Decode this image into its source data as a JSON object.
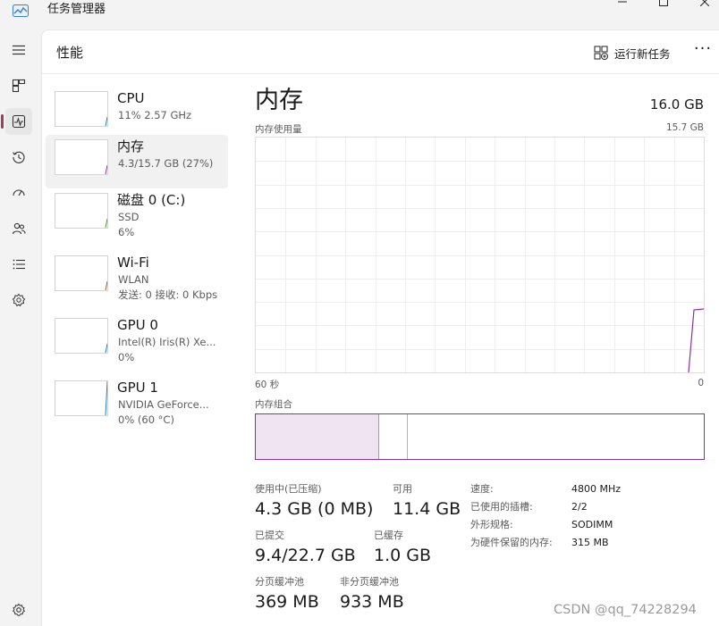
{
  "window": {
    "title": "任务管理器"
  },
  "nav": {
    "items": [
      {
        "id": "menu",
        "icon": "hamburger-icon"
      },
      {
        "id": "processes",
        "icon": "processes-icon"
      },
      {
        "id": "performance",
        "icon": "performance-icon",
        "active": true
      },
      {
        "id": "app-history",
        "icon": "history-icon"
      },
      {
        "id": "startup",
        "icon": "startup-icon"
      },
      {
        "id": "users",
        "icon": "users-icon"
      },
      {
        "id": "details",
        "icon": "details-icon"
      },
      {
        "id": "services",
        "icon": "services-icon"
      },
      {
        "id": "settings",
        "icon": "gear-icon"
      }
    ]
  },
  "header": {
    "title": "性能",
    "run_new_task": "运行新任务",
    "more": "···"
  },
  "resources": [
    {
      "name": "CPU",
      "sub1": "11%  2.57 GHz",
      "sub2": "",
      "color": "#1a7fd4"
    },
    {
      "name": "内存",
      "sub1": "4.3/15.7 GB (27%)",
      "sub2": "",
      "color": "#8b2fa5",
      "selected": true
    },
    {
      "name": "磁盘 0 (C:)",
      "sub1": "SSD",
      "sub2": "6%",
      "color": "#4c9a2a"
    },
    {
      "name": "Wi-Fi",
      "sub1": "WLAN",
      "sub2": "发送: 0 接收: 0 Kbps",
      "color": "#a05a1c"
    },
    {
      "name": "GPU 0",
      "sub1": "Intel(R) Iris(R) Xe...",
      "sub2": "0%",
      "color": "#1a7fd4"
    },
    {
      "name": "GPU 1",
      "sub1": "NVIDIA GeForce...",
      "sub2": "0% (60 °C)",
      "color": "#1a7fd4"
    }
  ],
  "detail": {
    "title": "内存",
    "total": "16.0 GB",
    "graph_label": "内存使用量",
    "graph_max": "15.7 GB",
    "time_left": "60 秒",
    "time_right": "0",
    "composition_label": "内存组合",
    "accent": "#8b2fa5",
    "usage_fraction": 0.27,
    "stats": {
      "in_use_label": "使用中(已压缩)",
      "in_use_value": "4.3 GB (0 MB)",
      "available_label": "可用",
      "available_value": "11.4 GB",
      "committed_label": "已提交",
      "committed_value": "9.4/22.7 GB",
      "cached_label": "已缓存",
      "cached_value": "1.0 GB",
      "paged_label": "分页缓冲池",
      "paged_value": "369 MB",
      "nonpaged_label": "非分页缓冲池",
      "nonpaged_value": "933 MB"
    },
    "specs": [
      {
        "key": "速度:",
        "value": "4800 MHz"
      },
      {
        "key": "已使用的插槽:",
        "value": "2/2"
      },
      {
        "key": "外形规格:",
        "value": "SODIMM"
      },
      {
        "key": "为硬件保留的内存:",
        "value": "315 MB"
      }
    ]
  },
  "watermark": "CSDN @qq_74228294"
}
